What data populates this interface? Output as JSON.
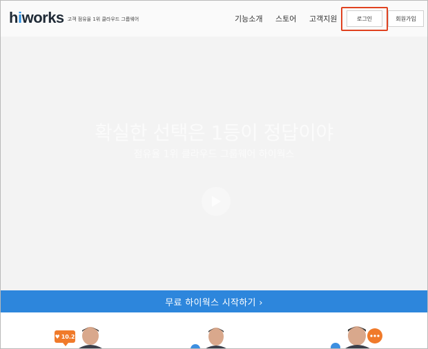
{
  "header": {
    "logo_text": "hiworks",
    "tagline": "고객 점유율 1위 클라우드 그룹웨어",
    "nav": [
      "기능소개",
      "스토어",
      "고객지원"
    ],
    "login_label": "로그인",
    "signup_label": "회원가입"
  },
  "hero": {
    "title": "확실한 선택은 1등이 정답이야",
    "subtitle": "점유율 1위 클라우드 그룹웨어 하이웍스"
  },
  "cta": {
    "label": "무료 하이웍스 시작하기 ›"
  },
  "promo": {
    "like_count": "10.2"
  },
  "colors": {
    "brand_blue": "#2d86dc",
    "accent_orange": "#f07a2a",
    "highlight_red": "#e0411f"
  }
}
